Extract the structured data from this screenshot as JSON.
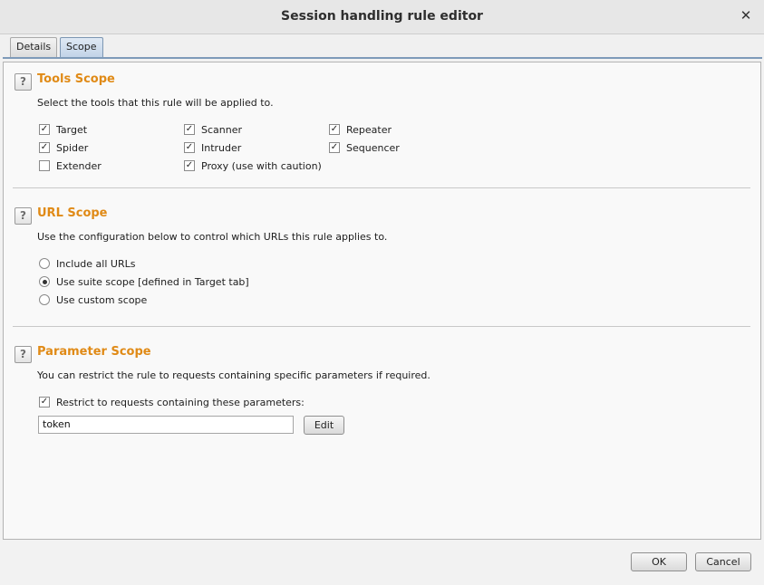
{
  "window": {
    "title": "Session handling rule editor",
    "close_glyph": "✕"
  },
  "tabs": [
    {
      "label": "Details",
      "active": false
    },
    {
      "label": "Scope",
      "active": true
    }
  ],
  "help_glyph": "?",
  "check_glyph": "✓",
  "tools_scope": {
    "title": "Tools Scope",
    "description": "Select the tools that this rule will be applied to.",
    "tools": [
      {
        "label": "Target",
        "checked": true
      },
      {
        "label": "Scanner",
        "checked": true
      },
      {
        "label": "Repeater",
        "checked": true
      },
      {
        "label": "Spider",
        "checked": true
      },
      {
        "label": "Intruder",
        "checked": true
      },
      {
        "label": "Sequencer",
        "checked": true
      },
      {
        "label": "Extender",
        "checked": false
      },
      {
        "label": "Proxy (use with caution)",
        "checked": true
      }
    ]
  },
  "url_scope": {
    "title": "URL Scope",
    "description": "Use the configuration below to control which URLs this rule applies to.",
    "options": [
      {
        "label": "Include all URLs",
        "selected": false
      },
      {
        "label": "Use suite scope [defined in Target tab]",
        "selected": true
      },
      {
        "label": "Use custom scope",
        "selected": false
      }
    ]
  },
  "parameter_scope": {
    "title": "Parameter Scope",
    "description": "You can restrict the rule to requests containing specific parameters if required.",
    "restrict_label": "Restrict to requests containing these parameters:",
    "restrict_checked": true,
    "parameters_value": "token",
    "edit_label": "Edit"
  },
  "footer": {
    "ok_label": "OK",
    "cancel_label": "Cancel"
  },
  "colors": {
    "section_title": "#e08a16",
    "tab_active": "#c2d4e8",
    "tab_underline": "#7e9ab9"
  }
}
